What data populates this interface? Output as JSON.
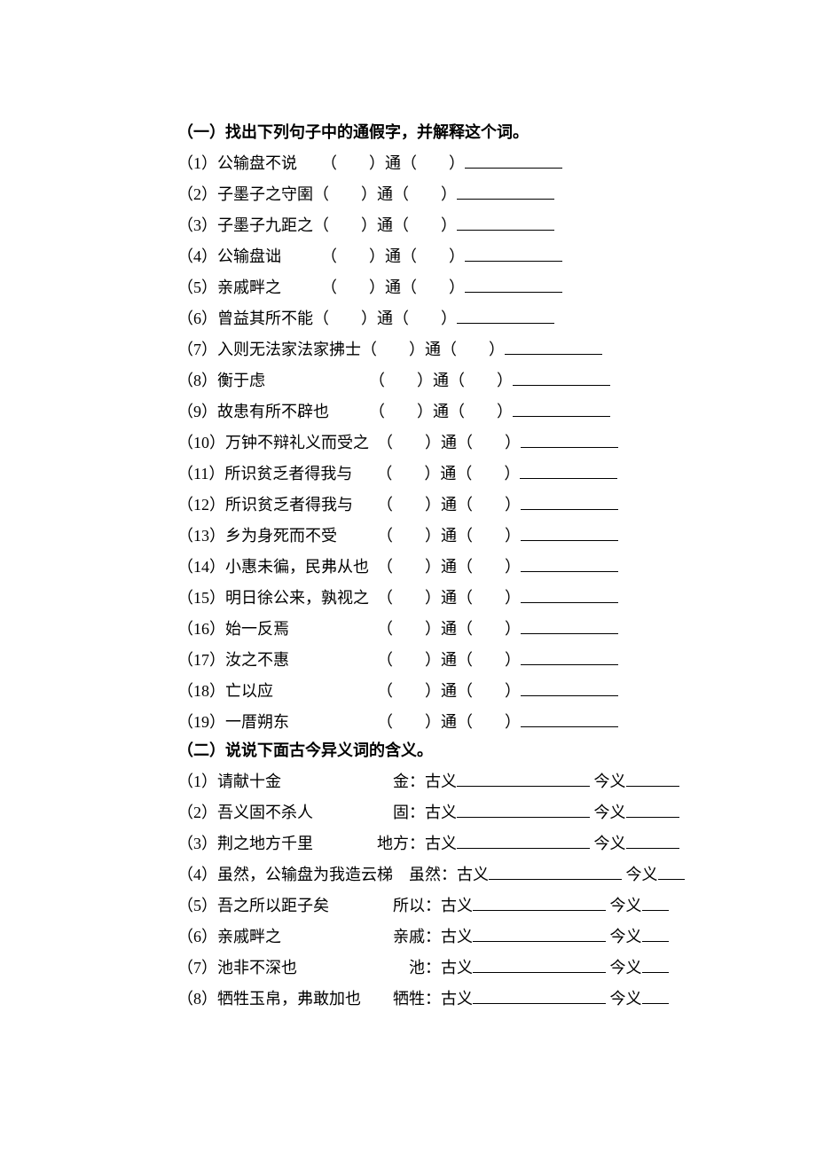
{
  "section1": {
    "title": "（一）找出下列句子中的通假字，并解释这个词。",
    "items": [
      {
        "n": "（1）",
        "text": "公输盘不说　　（　　）通（　　）",
        "ul": "u-med"
      },
      {
        "n": "（2）",
        "text": "子墨子之守圉（　　）通（　　）",
        "ul": "u-med"
      },
      {
        "n": "（3）",
        "text": "子墨子九距之（　　）通（　　）",
        "ul": "u-med"
      },
      {
        "n": "（4）",
        "text": "公输盘诎　　　（　　）通（　　）",
        "ul": "u-med"
      },
      {
        "n": "（5）",
        "text": "亲戚畔之　　　（　　）通（　　）",
        "ul": "u-med"
      },
      {
        "n": "（6）",
        "text": "曾益其所不能（　　）通（　　）",
        "ul": "u-med"
      },
      {
        "n": "（7）",
        "text": "入则无法家法家拂士（　　）通（　　）",
        "ul": "u-med"
      },
      {
        "n": "（8）",
        "text": "衡于虑　　　　　　　（　　）通（　　）",
        "ul": "u-med"
      },
      {
        "n": "（9）",
        "text": "故患有所不辟也　　　（　　）通（　　）",
        "ul": "u-med"
      },
      {
        "n": "（10）",
        "text": "万钟不辩礼义而受之　（　　）通（　　）",
        "ul": "u-med"
      },
      {
        "n": "（11）",
        "text": "所识贫乏者得我与　　（　　）通（　　）",
        "ul": "u-med"
      },
      {
        "n": "（12）",
        "text": "所识贫乏者得我与　　（　　）通（　　）",
        "ul": "u-med"
      },
      {
        "n": "（13）",
        "text": "乡为身死而不受　　　（　　）通（　　）",
        "ul": "u-med"
      },
      {
        "n": "（14）",
        "text": "小惠未徧，民弗从也　（　　）通（　　）",
        "ul": "u-med"
      },
      {
        "n": "（15）",
        "text": "明日徐公来，孰视之　（　　）通（　　）",
        "ul": "u-med"
      },
      {
        "n": "（16）",
        "text": "始一反焉　　　　　　（　　）通（　　）",
        "ul": "u-med"
      },
      {
        "n": "（17）",
        "text": "汝之不惠　　　　　　（　　）通（　　）",
        "ul": "u-med"
      },
      {
        "n": "（18）",
        "text": "亡以应　　　　　　　（　　）通（　　）",
        "ul": "u-med"
      },
      {
        "n": "（19）",
        "text": "一厝朔东　　　　　　（　　）通（　　）",
        "ul": "u-med"
      }
    ]
  },
  "section2": {
    "title": "（二）说说下面古今异义词的含义。",
    "items": [
      {
        "n": "（1）",
        "text": "请献十金　　　　　　　金：古义",
        "u1": "u-long",
        "mid": " 今义",
        "u2": "u-short"
      },
      {
        "n": "（2）",
        "text": "吾义固不杀人　　　　　固：古义",
        "u1": "u-long",
        "mid": " 今义",
        "u2": "u-short"
      },
      {
        "n": "（3）",
        "text": "荆之地方千里　　　　地方：古义",
        "u1": "u-long",
        "mid": " 今义",
        "u2": "u-short"
      },
      {
        "n": "（4）",
        "text": "虽然，公输盘为我造云梯　虽然：古义",
        "u1": "u-long",
        "mid": " 今义",
        "u2": "u-tiny"
      },
      {
        "n": "（5）",
        "text": "吾之所以距子矣　　　　所以：古义",
        "u1": "u-long",
        "mid": " 今义",
        "u2": "u-tiny"
      },
      {
        "n": "（6）",
        "text": "亲戚畔之　　　　　　　亲戚：古义",
        "u1": "u-long",
        "mid": " 今义",
        "u2": "u-tiny"
      },
      {
        "n": "（7）",
        "text": "池非不深也　　　　　　　池：古义",
        "u1": "u-long",
        "mid": " 今义",
        "u2": "u-tiny"
      },
      {
        "n": "（8）",
        "text": "牺牲玉帛，弗敢加也　　牺牲：古义",
        "u1": "u-long",
        "mid": " 今义",
        "u2": "u-tiny"
      }
    ]
  }
}
